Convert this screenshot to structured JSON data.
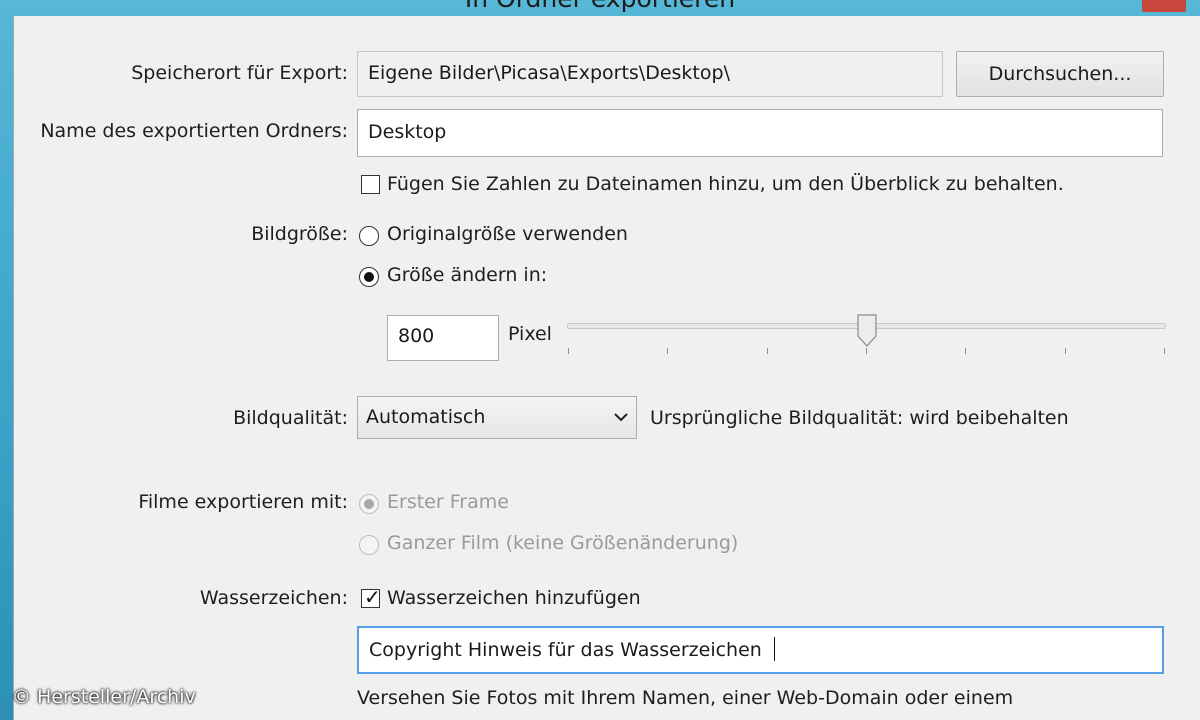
{
  "dialog": {
    "title": "In Ordner exportieren"
  },
  "location": {
    "label": "Speicherort für Export:",
    "value": "Eigene Bilder\\Picasa\\Exports\\Desktop\\",
    "browse_label": "Durchsuchen..."
  },
  "folder": {
    "label": "Name des exportierten Ordners:",
    "value": "Desktop"
  },
  "numbers_option": {
    "checked": false,
    "label": "Fügen Sie Zahlen zu Dateinamen hinzu, um den Überblick zu behalten."
  },
  "image_size": {
    "label": "Bildgröße:",
    "options": [
      {
        "label": "Originalgröße verwenden",
        "selected": false
      },
      {
        "label": "Größe ändern in:",
        "selected": true
      }
    ],
    "value": "800",
    "unit": "Pixel",
    "slider_fraction": 0.5
  },
  "quality": {
    "label": "Bildqualität:",
    "selected": "Automatisch",
    "note": "Ursprüngliche Bildqualität: wird beibehalten"
  },
  "movies": {
    "label": "Filme exportieren mit:",
    "options": [
      {
        "label": "Erster Frame",
        "selected": true,
        "enabled": false
      },
      {
        "label": "Ganzer Film (keine Größenänderung)",
        "selected": false,
        "enabled": false
      }
    ]
  },
  "watermark": {
    "label": "Wasserzeichen:",
    "checkbox_label": "Wasserzeichen hinzufügen",
    "checked": true,
    "text": "Copyright Hinweis für das Wasserzeichen",
    "hint": "Versehen Sie Fotos mit Ihrem Namen, einer Web-Domain oder einem"
  },
  "credit": "© Hersteller/Archiv"
}
